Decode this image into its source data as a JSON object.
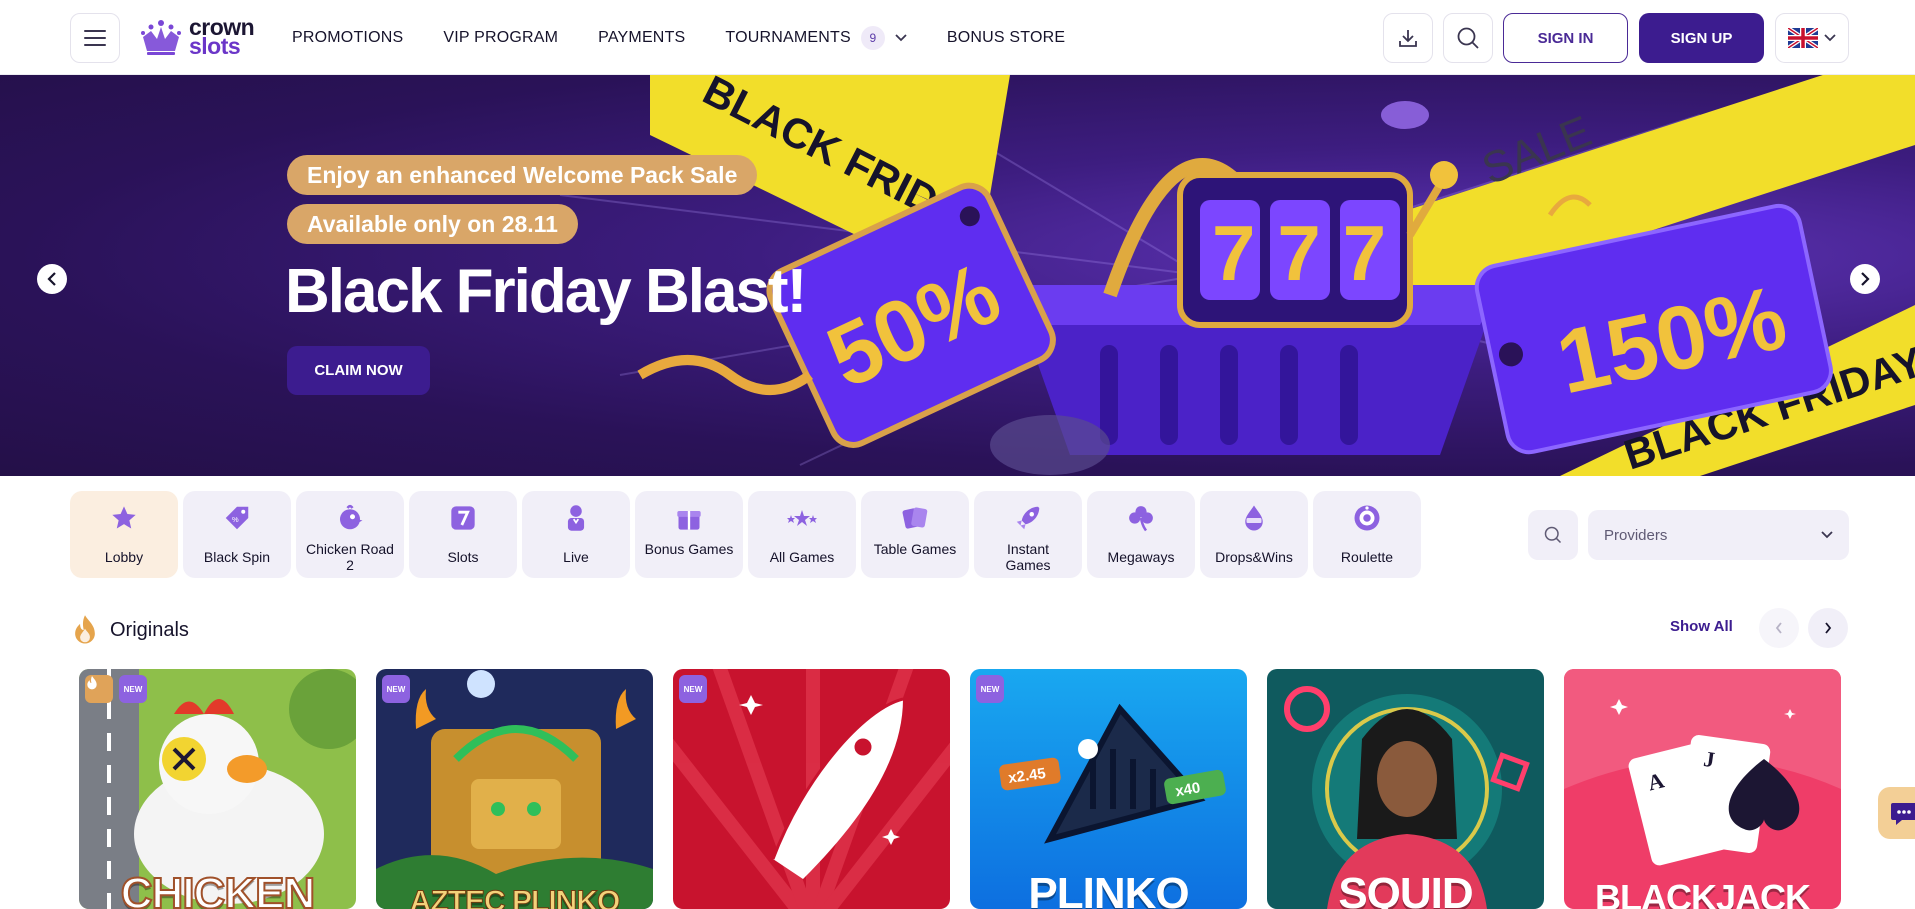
{
  "header": {
    "logo": {
      "line1": "crown",
      "line2": "slots"
    },
    "nav": [
      {
        "label": "PROMOTIONS"
      },
      {
        "label": "VIP PROGRAM"
      },
      {
        "label": "PAYMENTS"
      },
      {
        "label": "TOURNAMENTS",
        "badge": "9"
      },
      {
        "label": "BONUS STORE"
      }
    ],
    "sign_in": "SIGN IN",
    "sign_up": "SIGN UP",
    "accent": "#3c1c8f"
  },
  "hero": {
    "pill1": "Enjoy an enhanced Welcome Pack Sale",
    "pill2": "Available only on 28.11",
    "title": "Black Friday Blast!",
    "cta": "CLAIM NOW",
    "art_text": {
      "tape_top": "BLACK FRIDAY",
      "tape_bottom": "BLACK FRIDAY",
      "sale": "SALE",
      "tag_left": "50%",
      "tag_right": "150%",
      "reels": "777"
    }
  },
  "categories": [
    {
      "label": "Lobby",
      "icon": "star-icon"
    },
    {
      "label": "Black Spin",
      "icon": "tag-icon"
    },
    {
      "label": "Chicken Road 2",
      "icon": "chicken-icon"
    },
    {
      "label": "Slots",
      "icon": "slot-seven-icon"
    },
    {
      "label": "Live",
      "icon": "dealer-icon"
    },
    {
      "label": "Bonus Games",
      "icon": "gift-icon"
    },
    {
      "label": "All Games",
      "icon": "stars-icon"
    },
    {
      "label": "Table Games",
      "icon": "cards-icon"
    },
    {
      "label": "Instant Games",
      "icon": "rocket-icon"
    },
    {
      "label": "Megaways",
      "icon": "clover-icon"
    },
    {
      "label": "Drops&Wins",
      "icon": "drops-wins-icon"
    },
    {
      "label": "Roulette",
      "icon": "roulette-icon"
    }
  ],
  "filters": {
    "providers_placeholder": "Providers"
  },
  "originals": {
    "title": "Originals",
    "show_all": "Show All",
    "games": [
      {
        "title": "CHICKEN",
        "badge": "NEW",
        "hot": true
      },
      {
        "title": "AZTEC PLINKO",
        "badge": "NEW"
      },
      {
        "title": "",
        "badge": "NEW"
      },
      {
        "title": "PLINKO",
        "badge": "NEW",
        "multipliers": [
          "x2.45",
          "x40"
        ]
      },
      {
        "title": "SQUID"
      },
      {
        "title": "BLACKJACK"
      }
    ]
  }
}
